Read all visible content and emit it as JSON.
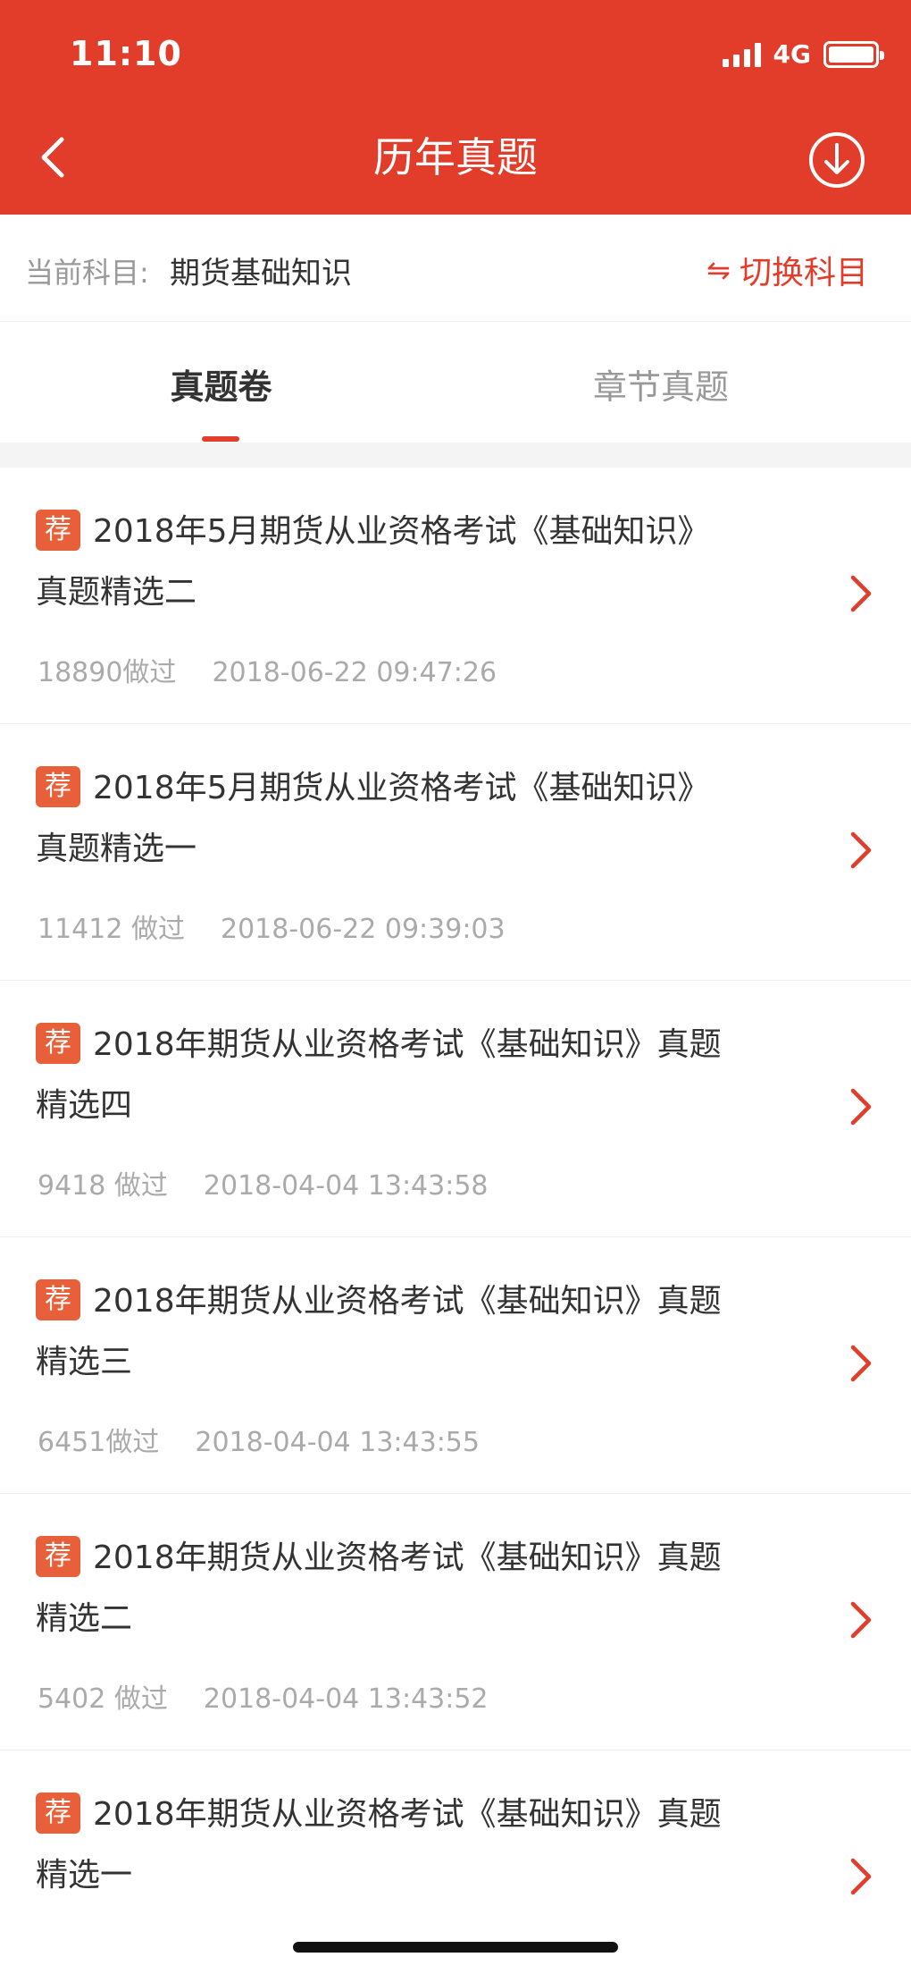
{
  "status_bar": {
    "time": "11:10",
    "network": "4G"
  },
  "nav": {
    "title": "历年真题"
  },
  "subject": {
    "label": "当前科目:",
    "value": "期货基础知识",
    "switch_label": "切换科目",
    "switch_icon": "⇋"
  },
  "tabs": [
    {
      "label": "真题卷"
    },
    {
      "label": "章节真题"
    }
  ],
  "badge": "荐",
  "items": [
    {
      "title": "2018年5月期货从业资格考试《基础知识》真题精选二",
      "done": "18890做过",
      "date": "2018-06-22 09:47:26"
    },
    {
      "title": "2018年5月期货从业资格考试《基础知识》真题精选一",
      "done": "11412 做过",
      "date": "2018-06-22 09:39:03"
    },
    {
      "title": "2018年期货从业资格考试《基础知识》真题精选四",
      "done": "9418 做过",
      "date": "2018-04-04 13:43:58"
    },
    {
      "title": "2018年期货从业资格考试《基础知识》真题精选三",
      "done": "6451做过",
      "date": "2018-04-04 13:43:55"
    },
    {
      "title": "2018年期货从业资格考试《基础知识》真题精选二",
      "done": "5402 做过",
      "date": "2018-04-04 13:43:52"
    },
    {
      "title": "2018年期货从业资格考试《基础知识》真题精选一",
      "done": "",
      "date": ""
    }
  ],
  "colors": {
    "accent": "#e23c2b",
    "badge": "#e8603a"
  }
}
